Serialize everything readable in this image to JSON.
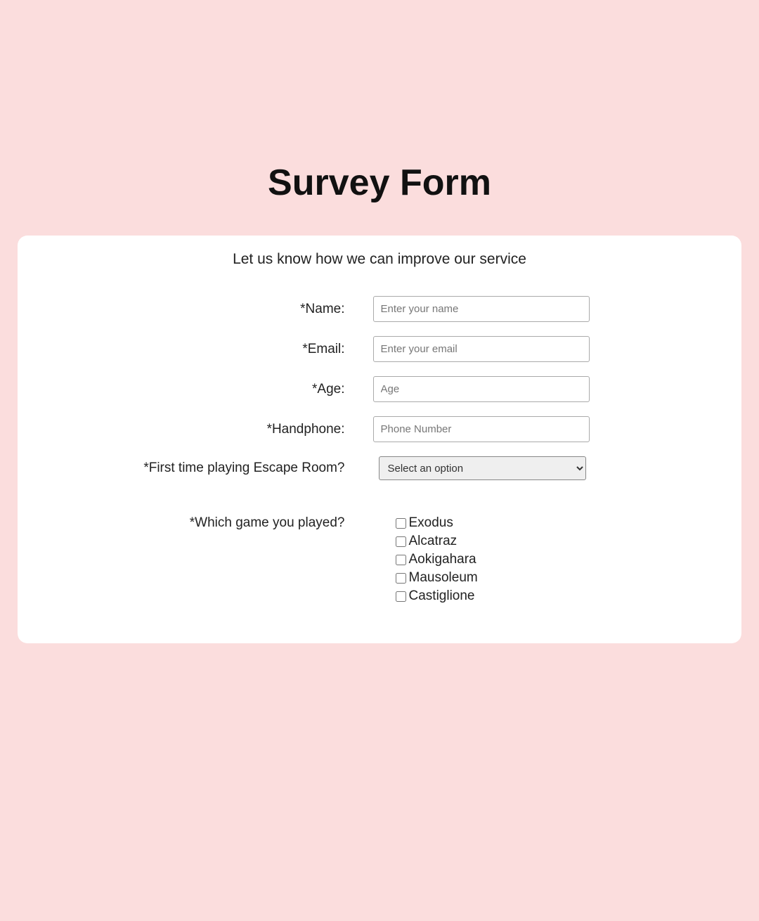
{
  "title": "Survey Form",
  "description": "Let us know how we can improve our service",
  "fields": {
    "name": {
      "label": "*Name:",
      "placeholder": "Enter your name"
    },
    "email": {
      "label": "*Email:",
      "placeholder": "Enter your email"
    },
    "age": {
      "label": "*Age:",
      "placeholder": "Age"
    },
    "handphone": {
      "label": "*Handphone:",
      "placeholder": "Phone Number"
    },
    "firstTime": {
      "label": "*First time playing Escape Room?",
      "selected": "Select an option"
    },
    "whichGame": {
      "label": "*Which game you played?"
    }
  },
  "games": {
    "0": "Exodus",
    "1": "Alcatraz",
    "2": "Aokigahara",
    "3": "Mausoleum",
    "4": "Castiglione"
  }
}
